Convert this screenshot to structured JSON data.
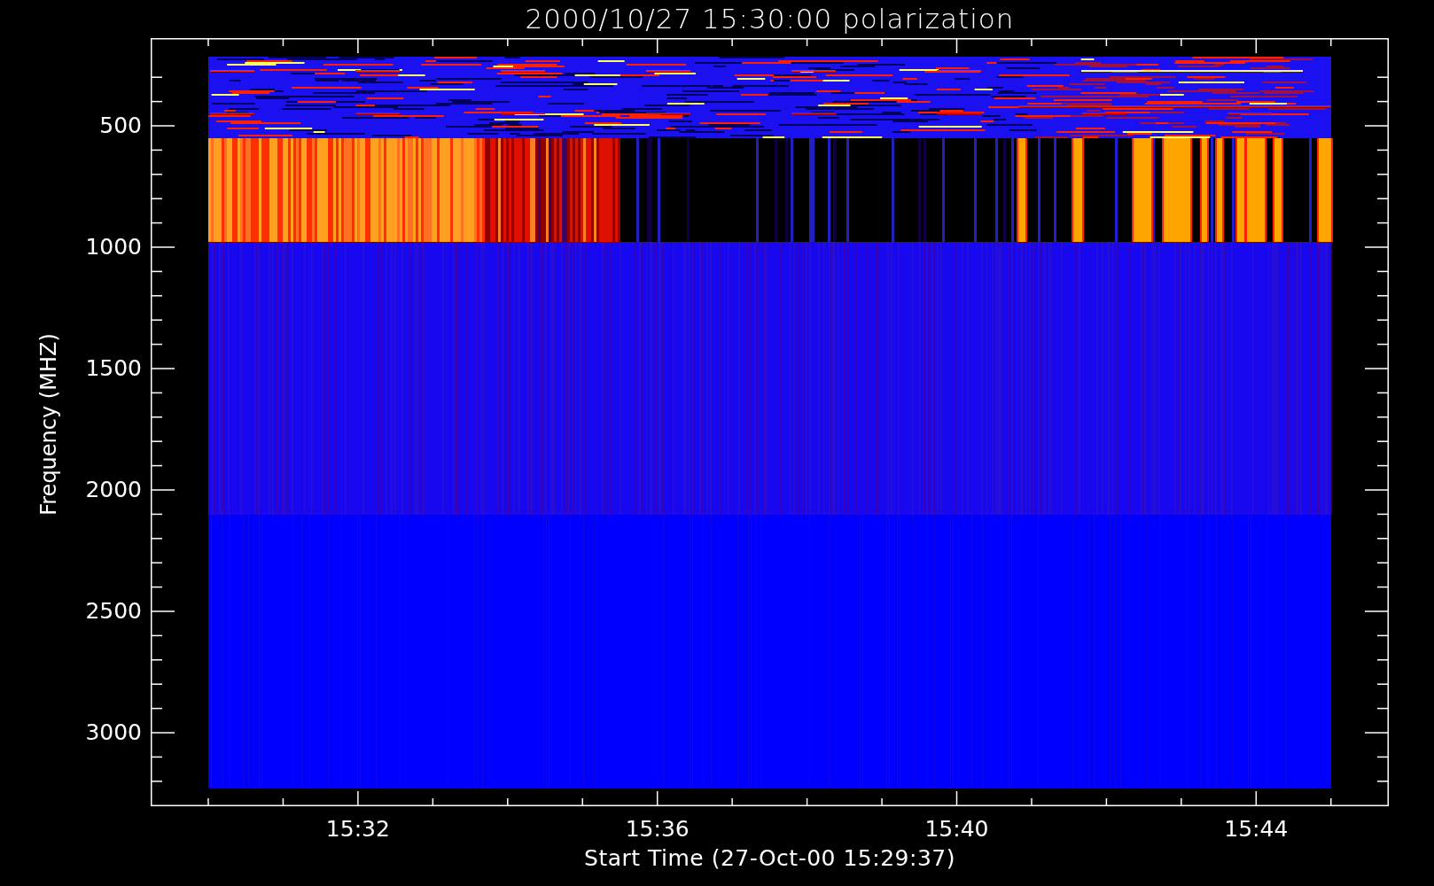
{
  "title": "2000/10/27 15:30:00 polarization",
  "y_axis": {
    "label": "Frequency (MHZ)",
    "ticks": [
      "500",
      "1000",
      "1500",
      "2000",
      "2500",
      "3000"
    ]
  },
  "x_axis": {
    "label": "Start Time (27-Oct-00 15:29:37)",
    "ticks": [
      "15:32",
      "15:36",
      "15:40",
      "15:44"
    ]
  }
}
